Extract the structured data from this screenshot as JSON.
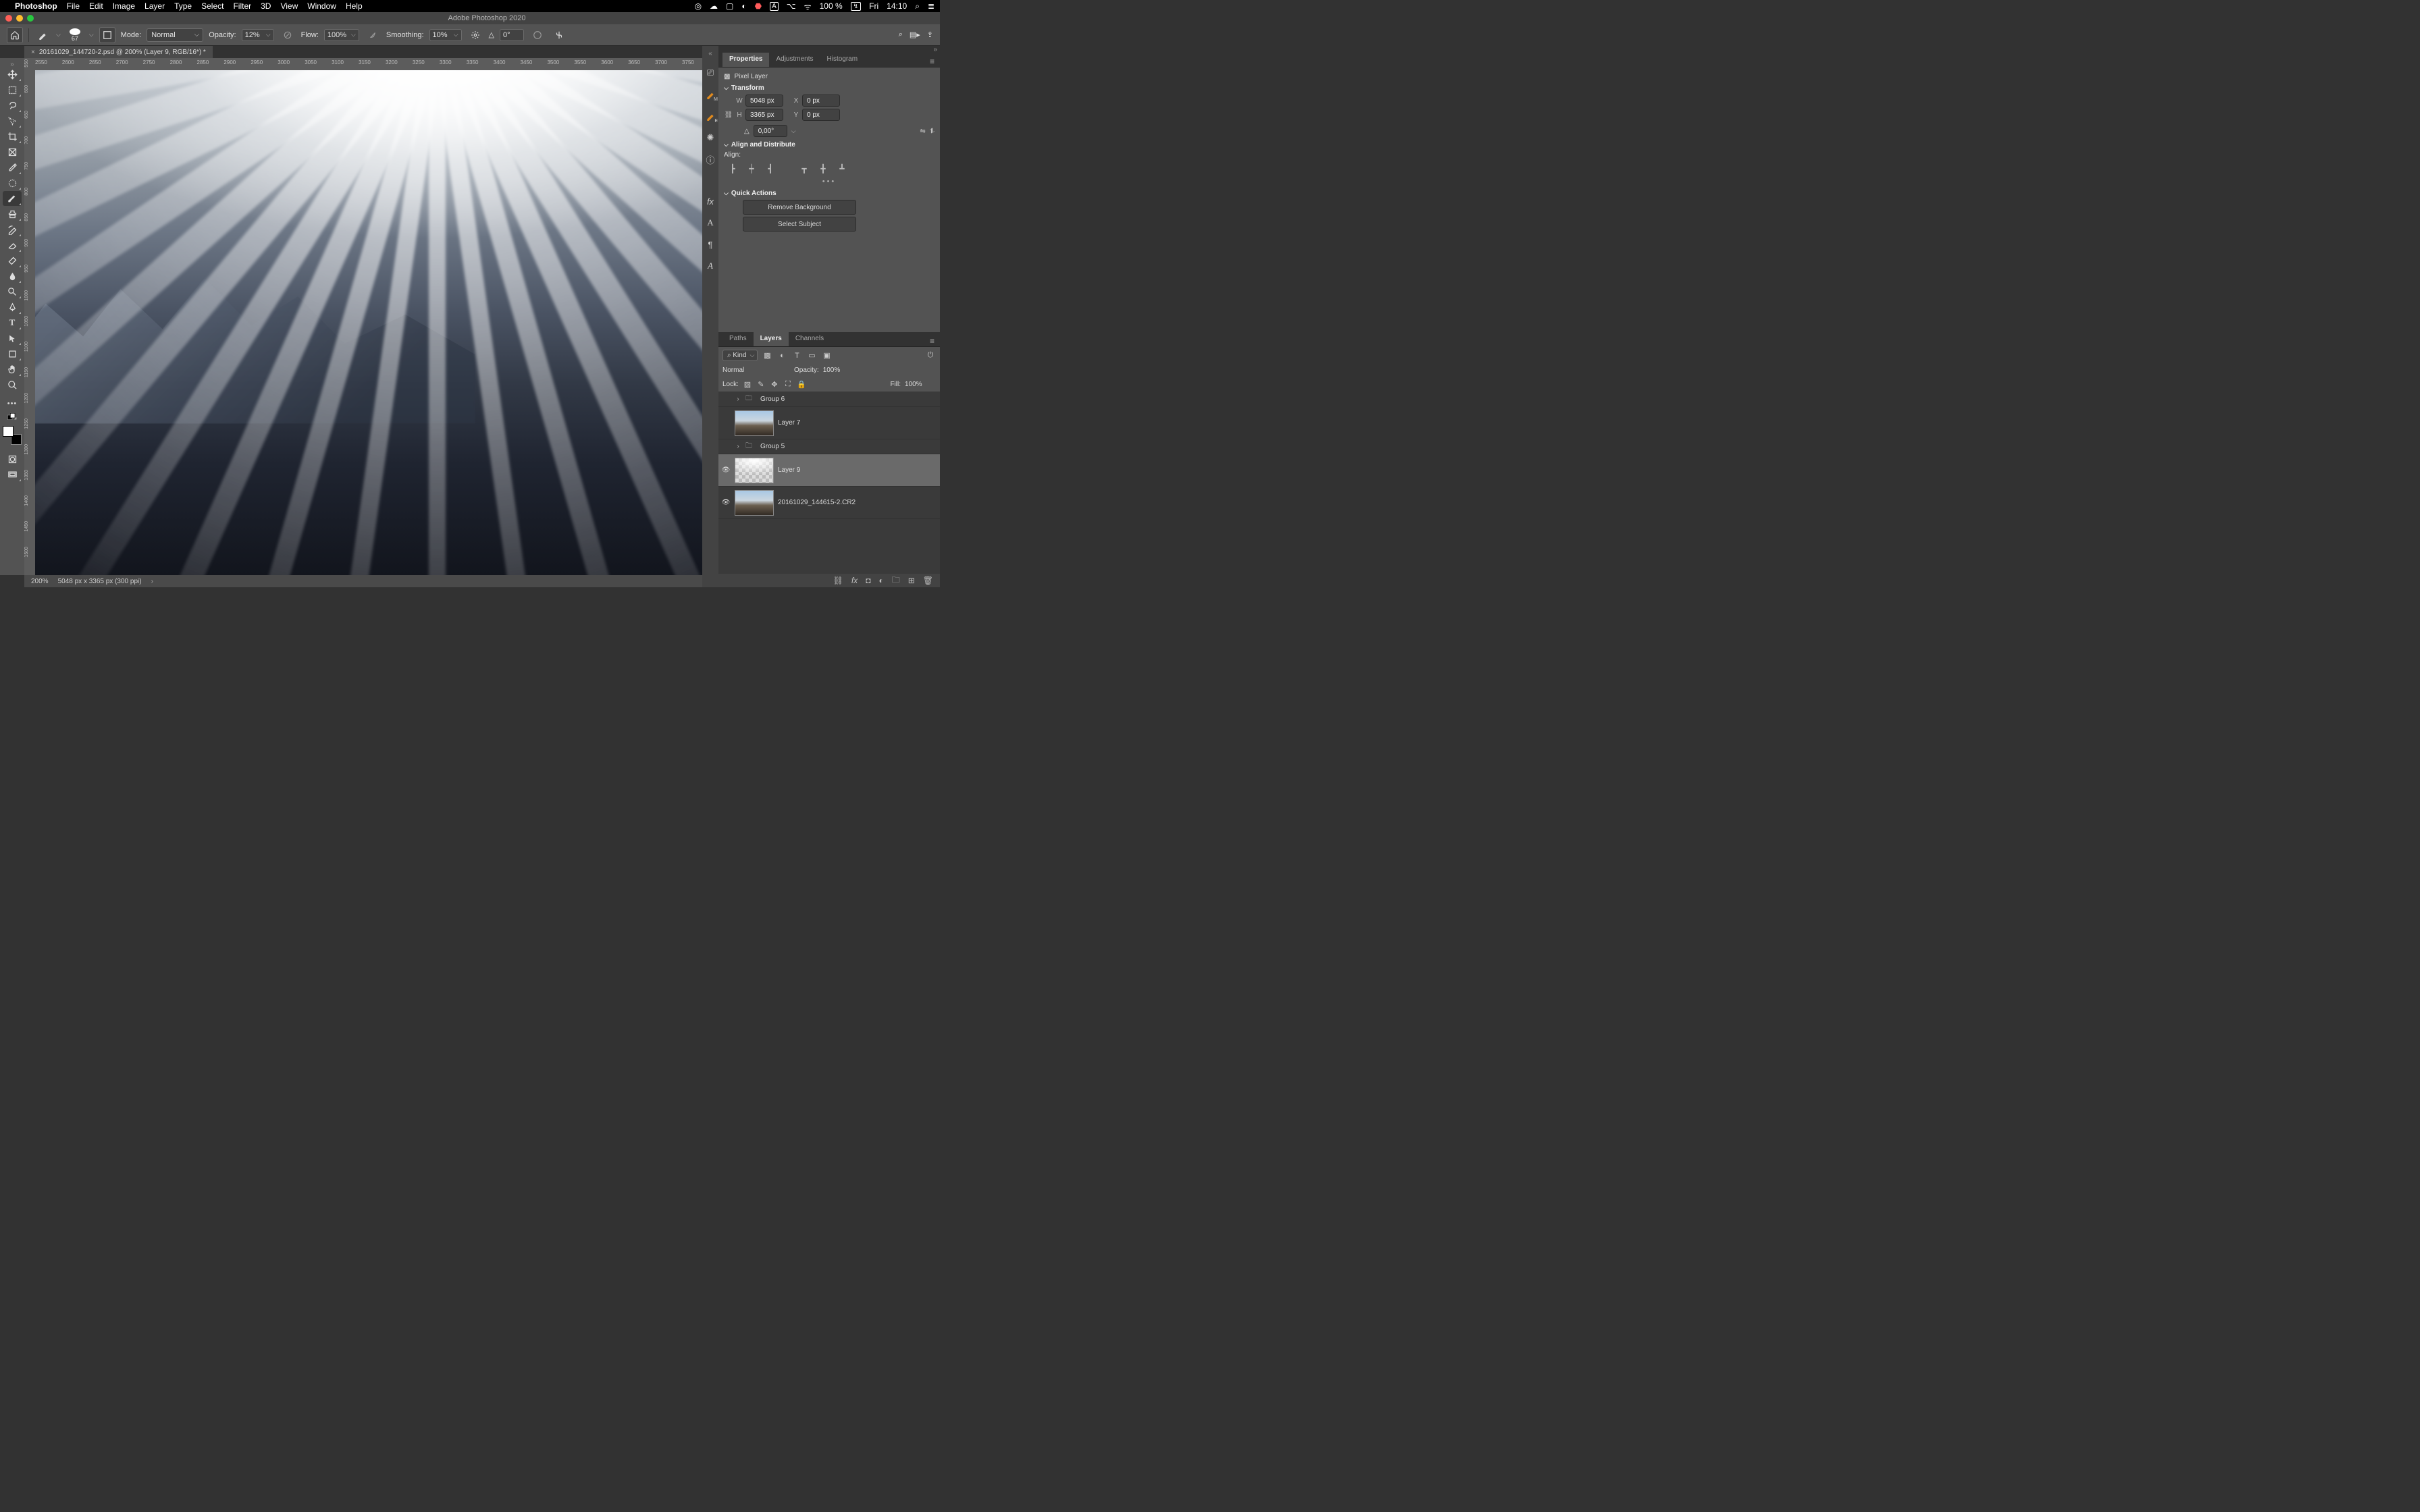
{
  "mac_menu": {
    "app": "Photoshop",
    "items": [
      "File",
      "Edit",
      "Image",
      "Layer",
      "Type",
      "Select",
      "Filter",
      "3D",
      "View",
      "Window",
      "Help"
    ],
    "battery": "100 %",
    "battery_icon": "↯",
    "day": "Fri",
    "time": "14:10"
  },
  "window_title": "Adobe Photoshop 2020",
  "doc_tab": "20161029_144720-2.psd @ 200% (Layer 9, RGB/16*) *",
  "options": {
    "brush_size": "67",
    "mode_label": "Mode:",
    "mode_value": "Normal",
    "opacity_label": "Opacity:",
    "opacity_value": "12%",
    "flow_label": "Flow:",
    "flow_value": "100%",
    "smoothing_label": "Smoothing:",
    "smoothing_value": "10%",
    "angle_label": "△",
    "angle_value": "0°"
  },
  "h_ruler_ticks": [
    "2550",
    "2600",
    "2650",
    "2700",
    "2750",
    "2800",
    "2850",
    "2900",
    "2950",
    "3000",
    "3050",
    "3100",
    "3150",
    "3200",
    "3250",
    "3300",
    "3350",
    "3400",
    "3450",
    "3500",
    "3550",
    "3600",
    "3650",
    "3700",
    "3750"
  ],
  "v_ruler_ticks": [
    "550",
    "600",
    "650",
    "700",
    "750",
    "800",
    "850",
    "900",
    "950",
    "1000",
    "1050",
    "1100",
    "1150",
    "1200",
    "1250",
    "1300",
    "1350",
    "1400",
    "1450",
    "1500"
  ],
  "panels_top": {
    "tabs": [
      "Properties",
      "Adjustments",
      "Histogram"
    ],
    "layer_kind": "Pixel Layer",
    "transform_label": "Transform",
    "W": "5048 px",
    "H": "3365 px",
    "X": "0 px",
    "Y": "0 px",
    "angle": "0,00°",
    "align_label": "Align and Distribute",
    "align_sub": "Align:",
    "quick_label": "Quick Actions",
    "qa1": "Remove Background",
    "qa2": "Select Subject"
  },
  "panels_bottom": {
    "tabs": [
      "Paths",
      "Layers",
      "Channels"
    ],
    "kind": "Kind",
    "blend": "Normal",
    "opacity_label": "Opacity:",
    "opacity_value": "100%",
    "lock_label": "Lock:",
    "fill_label": "Fill:",
    "fill_value": "100%",
    "layers": [
      {
        "type": "group",
        "visible": false,
        "name": "Group 6"
      },
      {
        "type": "pixel",
        "visible": false,
        "name": "Layer 7"
      },
      {
        "type": "group",
        "visible": false,
        "name": "Group 5"
      },
      {
        "type": "pixel",
        "visible": true,
        "name": "Layer 9",
        "selected": true
      },
      {
        "type": "pixel",
        "visible": true,
        "name": "20161029_144615-2.CR2"
      }
    ]
  },
  "status": {
    "zoom": "200%",
    "dims": "5048 px x 3365 px (300 ppi)"
  }
}
